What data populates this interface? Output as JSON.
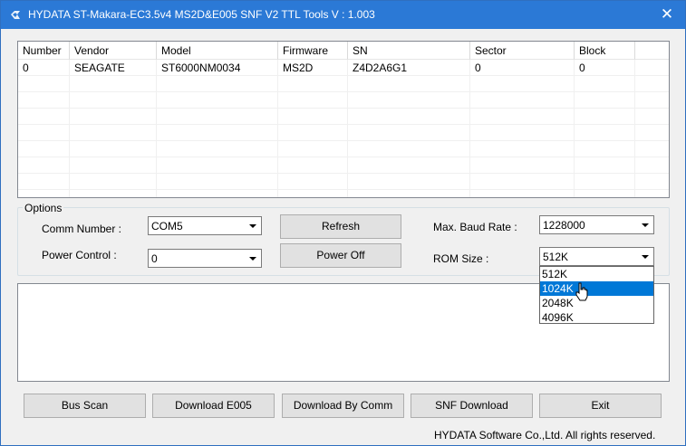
{
  "window": {
    "title": "HYDATA ST-Makara-EC3.5v4 MS2D&E005 SNF V2 TTL Tools V : 1.003",
    "close_glyph": "✕"
  },
  "drive_list": {
    "columns": [
      "Number",
      "Vendor",
      "Model",
      "Firmware",
      "SN",
      "Sector",
      "Block"
    ],
    "rows": [
      [
        "0",
        "SEAGATE",
        "ST6000NM0034",
        "MS2D",
        "Z4D2A6G1",
        "0",
        "0"
      ]
    ]
  },
  "options": {
    "group_label": "Options",
    "comm_number": {
      "label": "Comm Number :",
      "value": "COM5"
    },
    "power_control": {
      "label": "Power Control :",
      "value": "0"
    },
    "refresh_label": "Refresh",
    "power_off_label": "Power Off",
    "max_baud_rate": {
      "label": "Max. Baud Rate :",
      "value": "1228000"
    },
    "rom_size": {
      "label": "ROM Size :",
      "value": "512K",
      "options": [
        "512K",
        "1024K",
        "2048K",
        "4096K"
      ],
      "highlighted": "1024K"
    }
  },
  "actions": {
    "bus_scan": "Bus Scan",
    "download_e005": "Download E005",
    "download_by_comm": "Download By Comm",
    "snf_download": "SNF Download",
    "exit": "Exit"
  },
  "status_text": "HYDATA Software Co.,Ltd. All rights reserved.",
  "colors": {
    "titlebar": "#2b79d6",
    "selection": "#0078d7"
  }
}
